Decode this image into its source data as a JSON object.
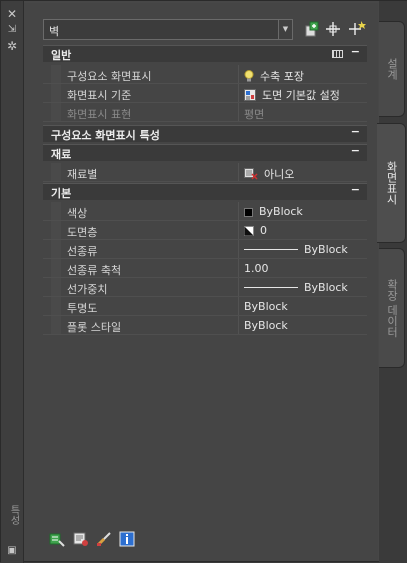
{
  "palette": {
    "select_value": "벽",
    "grip_buttons": [
      "close-icon",
      "pin-icon",
      "settings-icon"
    ],
    "vertical_title": "특성",
    "tabs": [
      {
        "label": "설계",
        "active": false
      },
      {
        "label": "화면표시",
        "active": true
      },
      {
        "label": "확장 데이터",
        "active": false
      }
    ]
  },
  "sections": {
    "general": {
      "title": "일반",
      "toggle": "−",
      "rows": [
        {
          "label": "구성요소 화면표시",
          "value": "수축 포장",
          "icon": "lightbulb-icon"
        },
        {
          "label": "화면표시 기준",
          "value": "도면 기본값 설정",
          "icon": "display-config-icon"
        },
        {
          "label": "화면표시 표현",
          "value": "평면"
        }
      ]
    },
    "component_display": {
      "title": "구성요소 화면표시 특성",
      "toggle": "−"
    },
    "material": {
      "title": "재료",
      "toggle": "−",
      "rows": [
        {
          "label": "재료별",
          "value": "아니오",
          "icon": "material-icon"
        }
      ]
    },
    "basic": {
      "title": "기본",
      "toggle": "−",
      "rows": [
        {
          "label": "색상",
          "value": "ByBlock",
          "icon": "color-swatch",
          "color": "#000000"
        },
        {
          "label": "도면층",
          "value": "0",
          "icon": "layer-icon"
        },
        {
          "label": "선종류",
          "value": "ByBlock",
          "icon": "linetype-sample"
        },
        {
          "label": "선종류 축척",
          "value": "1.00"
        },
        {
          "label": "선가중치",
          "value": "ByBlock",
          "icon": "lineweight-sample"
        },
        {
          "label": "투명도",
          "value": "ByBlock"
        },
        {
          "label": "플롯 스타일",
          "value": "ByBlock"
        }
      ]
    }
  },
  "colors": {
    "accent_green": "#3fa34d",
    "accent_blue": "#2d6fd0",
    "accent_yellow": "#e8d34a"
  }
}
